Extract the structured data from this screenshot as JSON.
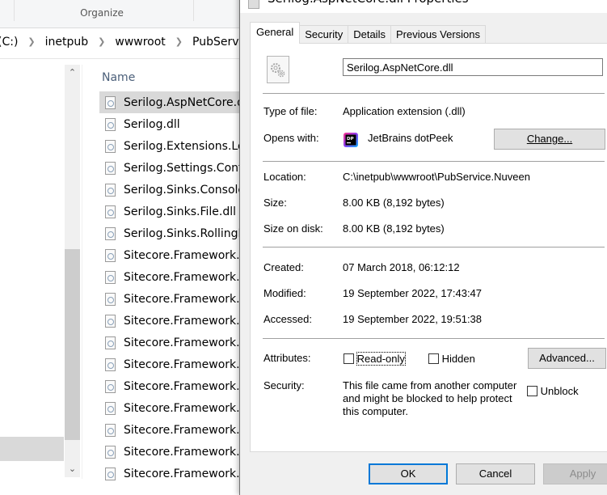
{
  "explorer": {
    "ribbon": {
      "group_label": "Organize"
    },
    "breadcrumb": [
      "(C:)",
      "inetpub",
      "wwwroot",
      "PubService.Nuveen"
    ],
    "column_header": "Name",
    "scrollbar": {
      "up_icon": "chevron-up-icon",
      "down_icon": "chevron-down-icon"
    },
    "files": [
      {
        "name": "Serilog.AspNetCore.dll",
        "selected": true
      },
      {
        "name": "Serilog.dll",
        "selected": false
      },
      {
        "name": "Serilog.Extensions.Logging.dll",
        "selected": false
      },
      {
        "name": "Serilog.Settings.Configuration.dll",
        "selected": false
      },
      {
        "name": "Serilog.Sinks.Console.dll",
        "selected": false
      },
      {
        "name": "Serilog.Sinks.File.dll",
        "selected": false
      },
      {
        "name": "Serilog.Sinks.RollingFile.dll",
        "selected": false
      },
      {
        "name": "Sitecore.Framework.C",
        "selected": false
      },
      {
        "name": "Sitecore.Framework.C",
        "selected": false
      },
      {
        "name": "Sitecore.Framework.C",
        "selected": false
      },
      {
        "name": "Sitecore.Framework.C",
        "selected": false
      },
      {
        "name": "Sitecore.Framework.C",
        "selected": false
      },
      {
        "name": "Sitecore.Framework.C",
        "selected": false
      },
      {
        "name": "Sitecore.Framework.C",
        "selected": false
      },
      {
        "name": "Sitecore.Framework.C",
        "selected": false
      },
      {
        "name": "Sitecore.Framework.C",
        "selected": false
      },
      {
        "name": "Sitecore.Framework.E",
        "selected": false
      },
      {
        "name": "Sitecore.Framework.E",
        "selected": false
      }
    ]
  },
  "dialog": {
    "title": "Serilog.AspNetCore.dll Properties",
    "tabs": [
      {
        "label": "General",
        "active": true
      },
      {
        "label": "Security",
        "active": false
      },
      {
        "label": "Details",
        "active": false
      },
      {
        "label": "Previous Versions",
        "active": false
      }
    ],
    "file_name": "Serilog.AspNetCore.dll",
    "type_of_file": {
      "label": "Type of file:",
      "value": "Application extension (.dll)"
    },
    "opens_with": {
      "label": "Opens with:",
      "value": "JetBrains dotPeek",
      "icon": "dotpeek-icon",
      "icon_text": "DP",
      "change_button": "Change..."
    },
    "location": {
      "label": "Location:",
      "value": "C:\\inetpub\\wwwroot\\PubService.Nuveen"
    },
    "size": {
      "label": "Size:",
      "value": "8.00 KB (8,192 bytes)"
    },
    "size_on_disk": {
      "label": "Size on disk:",
      "value": "8.00 KB (8,192 bytes)"
    },
    "created": {
      "label": "Created:",
      "value": "07 March 2018, 06:12:12"
    },
    "modified": {
      "label": "Modified:",
      "value": "19 September 2022, 17:43:47"
    },
    "accessed": {
      "label": "Accessed:",
      "value": "19 September 2022, 19:51:38"
    },
    "attributes": {
      "label": "Attributes:",
      "read_only": {
        "label": "Read-only",
        "checked": false
      },
      "hidden": {
        "label": "Hidden",
        "checked": false
      },
      "advanced_button": "Advanced..."
    },
    "security": {
      "label": "Security:",
      "text": "This file came from another computer and might be blocked to help protect this computer.",
      "unblock": {
        "label": "Unblock",
        "checked": false
      }
    },
    "buttons": {
      "ok": "OK",
      "cancel": "Cancel",
      "apply": "Apply",
      "apply_enabled": false
    },
    "colors": {
      "accent": "#0078d7",
      "panel_bg": "#ffffff",
      "dialog_bg": "#f0f0f0",
      "button_bg": "#e1e1e1"
    }
  }
}
